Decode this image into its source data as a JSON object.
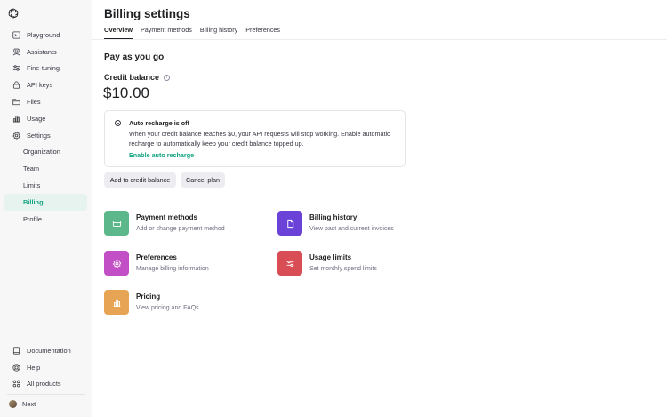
{
  "sidebar": {
    "items": [
      {
        "label": "Playground"
      },
      {
        "label": "Assistants"
      },
      {
        "label": "Fine-tuning"
      },
      {
        "label": "API keys"
      },
      {
        "label": "Files"
      },
      {
        "label": "Usage"
      },
      {
        "label": "Settings"
      },
      {
        "label": "Organization"
      },
      {
        "label": "Team"
      },
      {
        "label": "Limits"
      },
      {
        "label": "Billing"
      },
      {
        "label": "Profile"
      }
    ],
    "bottom": [
      {
        "label": "Documentation"
      },
      {
        "label": "Help"
      },
      {
        "label": "All products"
      }
    ],
    "user": {
      "label": "Next"
    }
  },
  "header": {
    "title": "Billing settings",
    "tabs": [
      {
        "label": "Overview"
      },
      {
        "label": "Payment methods"
      },
      {
        "label": "Billing history"
      },
      {
        "label": "Preferences"
      }
    ]
  },
  "main": {
    "section_title": "Pay as you go",
    "credit_label": "Credit balance",
    "credit_value": "$10.00",
    "recharge": {
      "title": "Auto recharge is off",
      "description": "When your credit balance reaches $0, your API requests will stop working. Enable automatic recharge to automatically keep your credit balance topped up.",
      "link": "Enable auto recharge"
    },
    "buttons": {
      "add": "Add to credit balance",
      "cancel": "Cancel plan"
    },
    "cards": [
      {
        "title": "Payment methods",
        "subtitle": "Add or change payment method",
        "color": "#5cb88a"
      },
      {
        "title": "Billing history",
        "subtitle": "View past and current invoices",
        "color": "#6a42d8"
      },
      {
        "title": "Preferences",
        "subtitle": "Manage billing information",
        "color": "#c24fc6"
      },
      {
        "title": "Usage limits",
        "subtitle": "Set monthly spend limits",
        "color": "#d94d55"
      },
      {
        "title": "Pricing",
        "subtitle": "View pricing and FAQs",
        "color": "#e8a455"
      }
    ]
  },
  "colors": {
    "accent": "#10a37f",
    "active_bg": "#e6f3ef"
  }
}
